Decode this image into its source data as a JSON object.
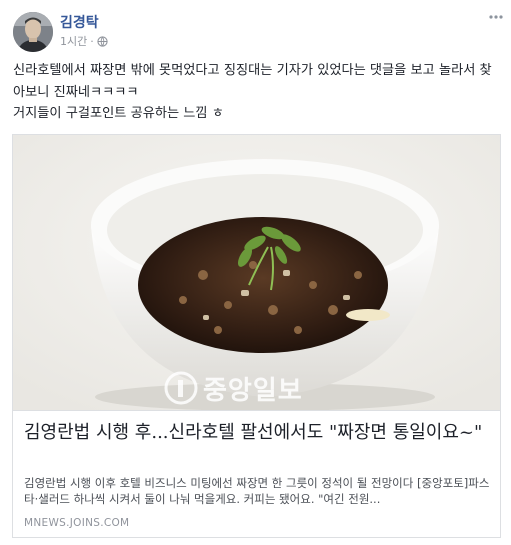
{
  "post": {
    "author": "김경탁",
    "time": "1시간",
    "separator": "·",
    "privacy_icon": "globe-icon",
    "more_icon": "more-options-icon",
    "text_line1": "신라호텔에서 짜장면 밖에 못먹었다고 징징대는 기자가 있었다는 댓글을 보고 놀라서 찾아보니 진짜네ㅋㅋㅋㅋ",
    "text_line2": "거지들이 구걸포인트 공유하는 느낌 ㅎ"
  },
  "link_card": {
    "image_desc_icon": "jajangmyeon-bowl-image",
    "watermark": "중앙일보",
    "title": "김영란법 시행 후...신라호텔 팔선에서도 \"짜장면 통일이요~\"",
    "description": "김영란법 시행 이후 호텔 비즈니스 미팅에선 짜장면 한 그릇이 정석이 될 전망이다 [중앙포토]파스타·샐러드 하나씩 시켜서 둘이 나눠 먹을게요. 커피는 됐어요. \"여긴 전원...",
    "domain": "MNEWS.JOINS.COM"
  }
}
